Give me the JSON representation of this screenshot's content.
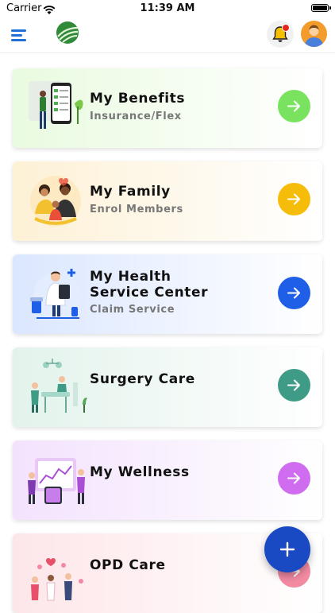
{
  "status_bar": {
    "carrier": "Carrier",
    "time": "11:39 AM"
  },
  "header": {
    "menu_icon": "hamburger-icon",
    "logo": "leaf-logo",
    "notifications_icon": "bell-icon",
    "profile_icon": "user-avatar"
  },
  "cards": [
    {
      "title": "My Benefits",
      "subtitle": "Insurance/Flex",
      "accent": "#79e35f",
      "bg_from": "#e9fbe0",
      "icon": "phone-benefits-illustration"
    },
    {
      "title": "My Family",
      "subtitle": "Enrol Members",
      "accent": "#f5bd0a",
      "bg_from": "#fdf1d6",
      "icon": "family-illustration"
    },
    {
      "title": "My Health",
      "title_line2": "Service Center",
      "subtitle": "Claim Service",
      "accent": "#1f5ee6",
      "bg_from": "#dbe7ff",
      "icon": "doctor-illustration"
    },
    {
      "title": "Surgery Care",
      "subtitle": "",
      "accent": "#3e9b86",
      "bg_from": "#e3f3ec",
      "icon": "surgery-illustration"
    },
    {
      "title": "My Wellness",
      "subtitle": "",
      "accent": "#cf6cf0",
      "bg_from": "#f3e2fd",
      "icon": "wellness-illustration"
    },
    {
      "title": "OPD Care",
      "subtitle": "",
      "accent": "#f28aa2",
      "bg_from": "#fde6e9",
      "icon": "opd-illustration"
    }
  ],
  "fab": {
    "icon": "plus-icon",
    "color": "#1a49c4"
  }
}
